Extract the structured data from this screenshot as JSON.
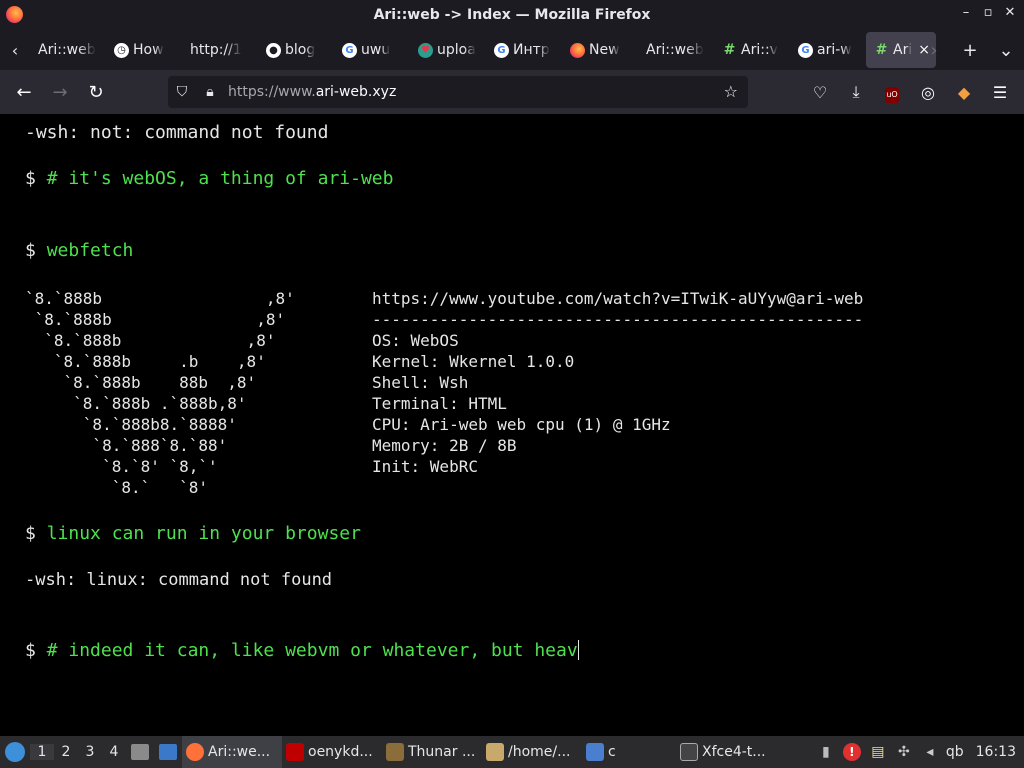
{
  "window": {
    "title": "Ari::web -> Index — Mozilla Firefox"
  },
  "tabs": [
    {
      "label": "Ari::web",
      "icon": "page-icon"
    },
    {
      "label": "How",
      "icon": "clock-icon"
    },
    {
      "label": "http://1",
      "icon": "none"
    },
    {
      "label": "blog",
      "icon": "github-icon"
    },
    {
      "label": "uwu",
      "icon": "google-icon"
    },
    {
      "label": "uploa",
      "icon": "site-icon"
    },
    {
      "label": "Интр",
      "icon": "google-icon"
    },
    {
      "label": "New",
      "icon": "firefox-icon"
    },
    {
      "label": "Ari::web",
      "icon": "none"
    },
    {
      "label": "Ari::v",
      "icon": "hash-icon"
    },
    {
      "label": "ari-w",
      "icon": "google-icon"
    },
    {
      "label": "Ari",
      "icon": "hash-icon",
      "active": true
    }
  ],
  "urlbar": {
    "protocol": "https://www.",
    "domain": "ari-web.xyz"
  },
  "terminal": {
    "line1": "-wsh: not: command not found",
    "prompt": "$",
    "cmd1": "# it's webOS, a thing of ari-web",
    "cmd2": "webfetch",
    "art": "`8.`888b                 ,8'\n `8.`888b               ,8'\n  `8.`888b             ,8'\n   `8.`888b     .b    ,8'\n    `8.`888b    88b  ,8'\n     `8.`888b .`888b,8'\n      `8.`888b8.`8888'\n       `8.`888`8.`88'\n        `8.`8' `8,`'\n         `8.`   `8'",
    "info": "https://www.youtube.com/watch?v=ITwiK-aUYyw@ari-web\n---------------------------------------------------\nOS: WebOS\nKernel: Wkernel 1.0.0\nShell: Wsh\nTerminal: HTML\nCPU: Ari-web web cpu (1) @ 1GHz\nMemory: 2B / 8B\nInit: WebRC",
    "cmd3": "linux can run in your browser",
    "line2": "-wsh: linux: command not found",
    "cmd4": "# indeed it can, like webvm or whatever, but heav"
  },
  "taskbar": {
    "workspaces": [
      "1",
      "2",
      "3",
      "4"
    ],
    "tasks": [
      {
        "label": "Ari::we...",
        "color": "#ff7139"
      },
      {
        "label": "oenykd...",
        "color": "#bf0000"
      },
      {
        "label": "Thunar ...",
        "color": "#8a6d3b"
      },
      {
        "label": "/home/...",
        "color": "#c9a86b"
      },
      {
        "label": "c",
        "color": "#4a7fd0"
      },
      {
        "label": "Xfce4-t...",
        "color": "#444444"
      }
    ],
    "tray_text": "qb",
    "clock": "16:13"
  }
}
